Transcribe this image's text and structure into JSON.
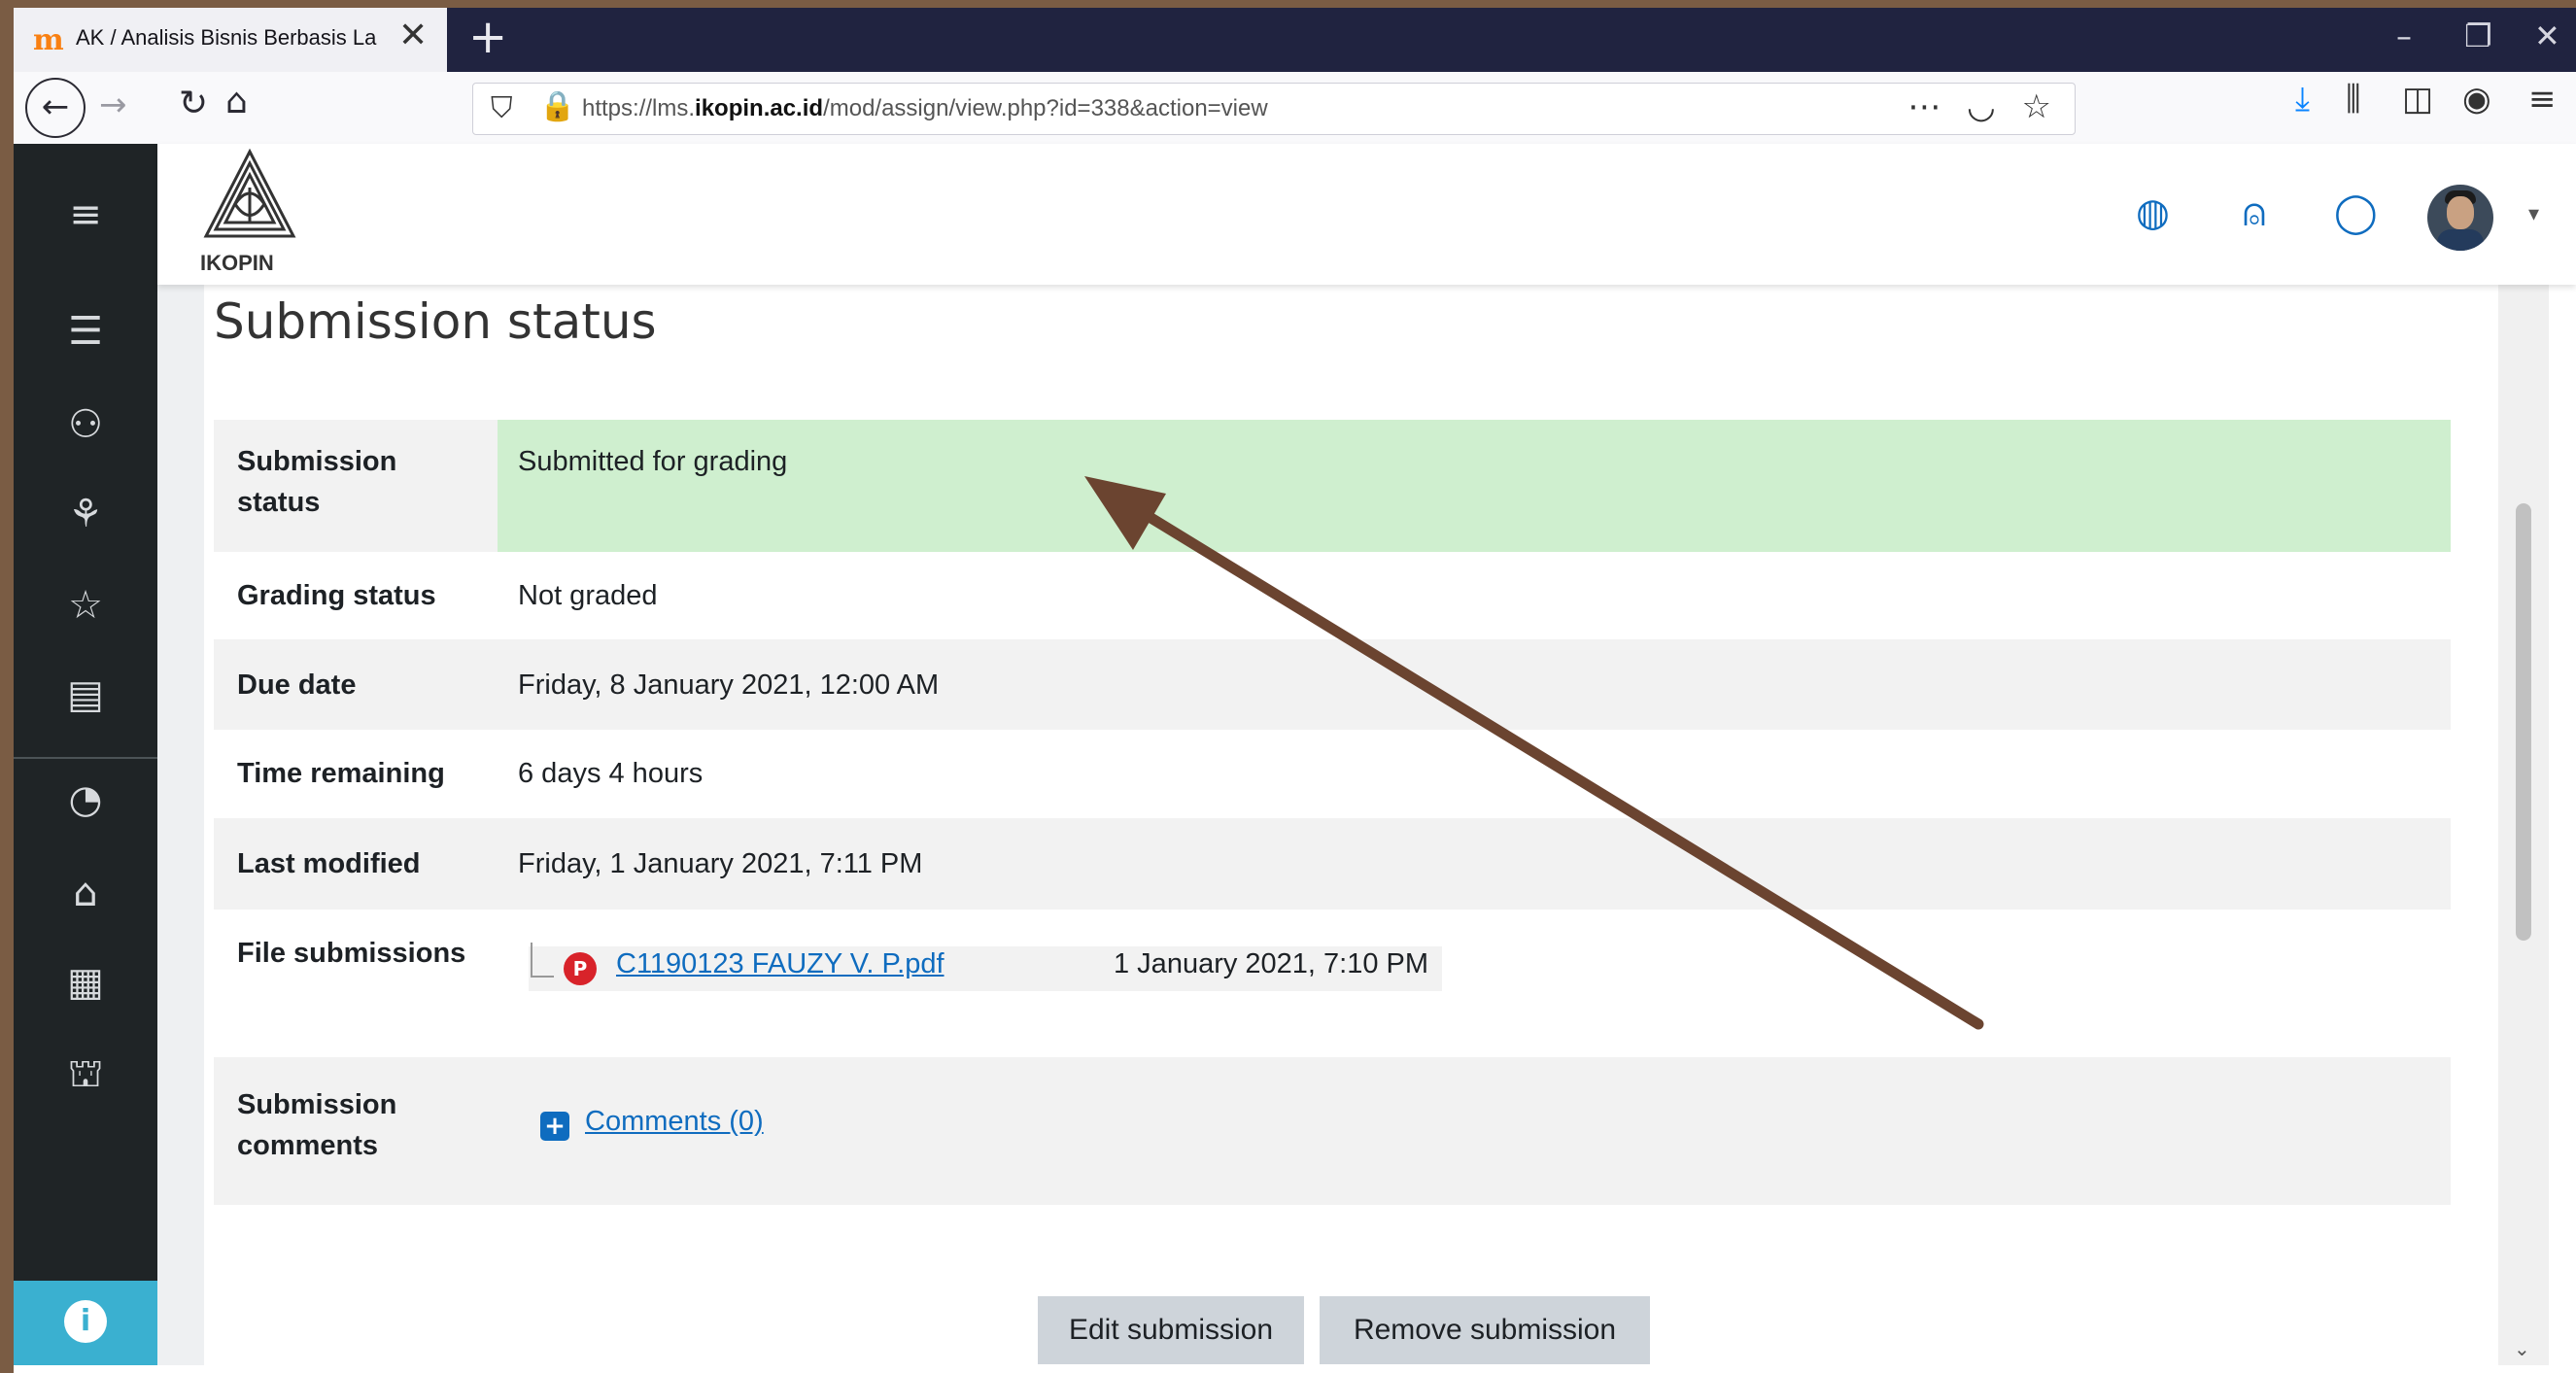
{
  "browser": {
    "tab_favicon": "m",
    "tab_title": "AK / Analisis Bisnis Berbasis Lap",
    "tab_close": "✕",
    "new_tab": "+",
    "url_prefix": "https://lms.",
    "url_domain": "ikopin.ac.id",
    "url_path": "/mod/assign/view.php?id=338&action=view",
    "window_buttons": [
      "–",
      "❐",
      "✕"
    ]
  },
  "header": {
    "logo_text": "IKOPIN"
  },
  "page": {
    "title": "Submission status"
  },
  "status_table": {
    "submission_status_label": "Submission status",
    "submission_status_value": "Submitted for grading",
    "grading_status_label": "Grading status",
    "grading_status_value": "Not graded",
    "due_date_label": "Due date",
    "due_date_value": "Friday, 8 January 2021, 12:00 AM",
    "time_remaining_label": "Time remaining",
    "time_remaining_value": "6 days 4 hours",
    "last_modified_label": "Last modified",
    "last_modified_value": "Friday, 1 January 2021, 7:11 PM",
    "file_submissions_label": "File submissions",
    "file_name": "C1190123 FAUZY V. P.pdf",
    "file_date": "1 January 2021, 7:10 PM",
    "comments_label": "Submission comments",
    "comments_link": "Comments (0)"
  },
  "buttons": {
    "edit": "Edit submission",
    "remove": "Remove submission"
  },
  "colors": {
    "success_row": "#cfefcf",
    "link": "#0f6cbf",
    "sidebar": "#1f2426",
    "arrow": "#6b4430"
  }
}
